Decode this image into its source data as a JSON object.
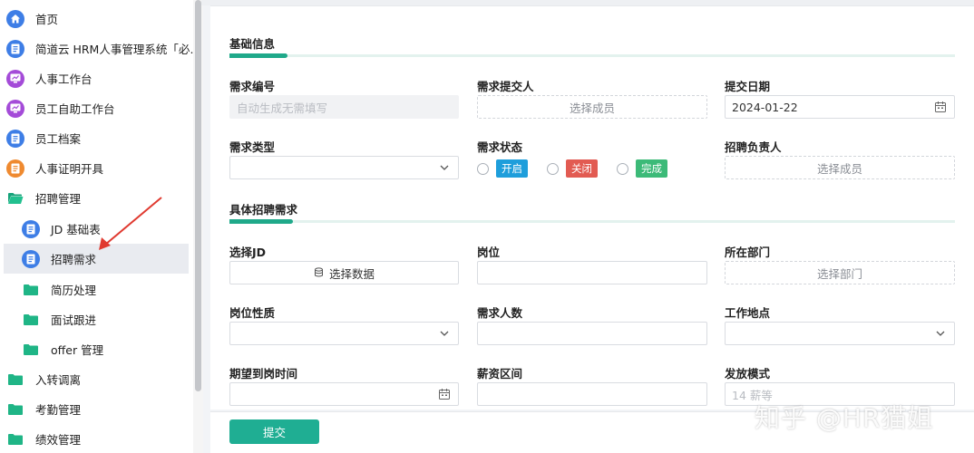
{
  "sidebar": {
    "items": [
      {
        "label": "首页",
        "icon": "home-icon"
      },
      {
        "label": "简道云 HRM人事管理系统「必…",
        "icon": "doc-icon"
      },
      {
        "label": "人事工作台",
        "icon": "dashboard-icon"
      },
      {
        "label": "员工自助工作台",
        "icon": "dashboard-icon"
      },
      {
        "label": "员工档案",
        "icon": "doc-icon"
      },
      {
        "label": "人事证明开具",
        "icon": "doc-icon"
      },
      {
        "label": "招聘管理",
        "icon": "folder-open-icon"
      },
      {
        "label": "JD 基础表",
        "icon": "doc-icon"
      },
      {
        "label": "招聘需求",
        "icon": "doc-icon"
      },
      {
        "label": "简历处理",
        "icon": "folder-icon"
      },
      {
        "label": "面试跟进",
        "icon": "folder-icon"
      },
      {
        "label": "offer 管理",
        "icon": "folder-icon"
      },
      {
        "label": "入转调离",
        "icon": "folder-icon"
      },
      {
        "label": "考勤管理",
        "icon": "folder-icon"
      },
      {
        "label": "绩效管理",
        "icon": "folder-icon"
      }
    ]
  },
  "colors": {
    "accent": "#1fae93",
    "active_bg": "#e9ebf0",
    "arrow": "#e03a30"
  },
  "form": {
    "section1": "基础信息",
    "section2": "具体招聘需求",
    "req_no_label": "需求编号",
    "req_no_placeholder": "自动生成无需填写",
    "submitter_label": "需求提交人",
    "submitter_btn": "选择成员",
    "date_label": "提交日期",
    "date_value": "2024-01-22",
    "type_label": "需求类型",
    "status_label": "需求状态",
    "status_options": [
      "开启",
      "关闭",
      "完成"
    ],
    "owner_label": "招聘负责人",
    "owner_btn": "选择成员",
    "jd_label": "选择JD",
    "jd_btn": "选择数据",
    "position_label": "岗位",
    "dept_label": "所在部门",
    "dept_btn": "选择部门",
    "nature_label": "岗位性质",
    "headcount_label": "需求人数",
    "location_label": "工作地点",
    "arrival_label": "期望到岗时间",
    "salary_label": "薪资区间",
    "pay_label": "发放模式",
    "pay_placeholder": "14 薪等"
  },
  "footer": {
    "submit": "提交"
  },
  "watermark": "知乎 @HR猫姐"
}
